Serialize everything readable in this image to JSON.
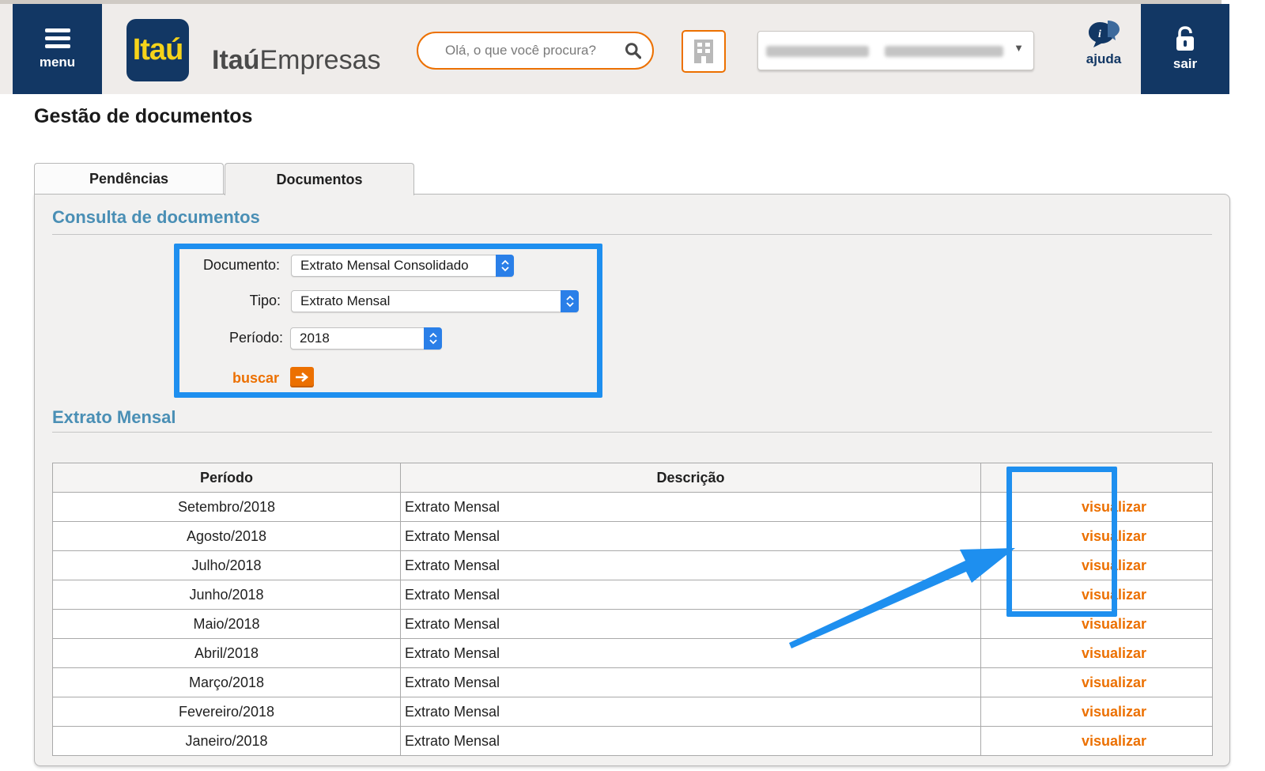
{
  "header": {
    "menu_label": "menu",
    "logo_text": "Itaú",
    "brand_bold": "Itaú",
    "brand_light": "Empresas",
    "search_placeholder": "Olá, o que você procura?",
    "help_label": "ajuda",
    "logout_label": "sair",
    "accent_color": "#ec7000",
    "navy_color": "#123764"
  },
  "page": {
    "title": "Gestão de documentos"
  },
  "tabs": [
    {
      "label": "Pendências",
      "active": false
    },
    {
      "label": "Documentos",
      "active": true
    }
  ],
  "consulta": {
    "title": "Consulta de documentos",
    "documento_label": "Documento:",
    "documento_value": "Extrato Mensal Consolidado",
    "tipo_label": "Tipo:",
    "tipo_value": "Extrato Mensal",
    "periodo_label": "Período:",
    "periodo_value": "2018",
    "buscar_label": "buscar"
  },
  "extrato": {
    "title": "Extrato Mensal",
    "columns": [
      "Período",
      "Descrição",
      ""
    ],
    "action_label": "visualizar",
    "rows": [
      {
        "periodo": "Setembro/2018",
        "descricao": "Extrato Mensal"
      },
      {
        "periodo": "Agosto/2018",
        "descricao": "Extrato Mensal"
      },
      {
        "periodo": "Julho/2018",
        "descricao": "Extrato Mensal"
      },
      {
        "periodo": "Junho/2018",
        "descricao": "Extrato Mensal"
      },
      {
        "periodo": "Maio/2018",
        "descricao": "Extrato Mensal"
      },
      {
        "periodo": "Abril/2018",
        "descricao": "Extrato Mensal"
      },
      {
        "periodo": "Março/2018",
        "descricao": "Extrato Mensal"
      },
      {
        "periodo": "Fevereiro/2018",
        "descricao": "Extrato Mensal"
      },
      {
        "periodo": "Janeiro/2018",
        "descricao": "Extrato Mensal"
      }
    ]
  },
  "annotation_color": "#1e8fef"
}
